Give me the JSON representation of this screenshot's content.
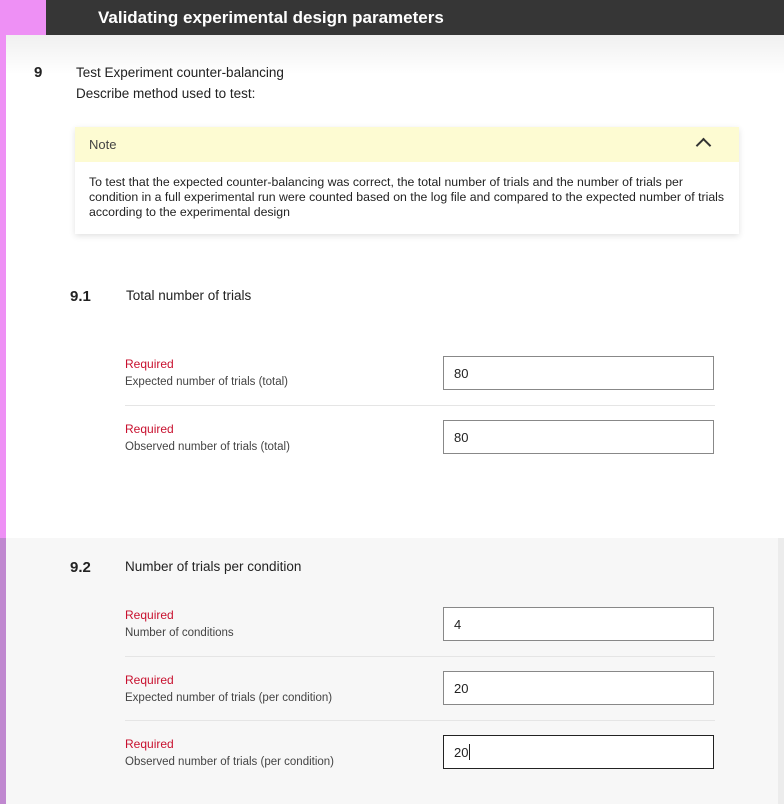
{
  "header": {
    "title": "Validating experimental design parameters"
  },
  "step": {
    "number": "9",
    "title": "Test Experiment counter-balancing",
    "description": "Describe method used to test:"
  },
  "note": {
    "title": "Note",
    "body": "To test that the expected counter-balancing was correct, the total number of trials and the number of trials per condition in a full experimental run were counted based on the log file and compared to the expected number  of trials according to the experimental design"
  },
  "sections": [
    {
      "number": "9.1",
      "title": "Total number of trials",
      "fields": [
        {
          "required": "Required",
          "label": "Expected number of trials (total)",
          "value": "80"
        },
        {
          "required": "Required",
          "label": "Observed number of trials (total)",
          "value": "80"
        }
      ]
    },
    {
      "number": "9.2",
      "title": "Number of trials per condition",
      "fields": [
        {
          "required": "Required",
          "label": "Number of conditions",
          "value": "4"
        },
        {
          "required": "Required",
          "label": "Expected number of trials (per condition)",
          "value": "20"
        },
        {
          "required": "Required",
          "label": "Observed number of trials (per condition)",
          "value": "20"
        }
      ]
    }
  ],
  "colors": {
    "accent_pink": "#ee90f5",
    "header_bg": "#363636",
    "note_header_bg": "#fdfbd2",
    "required_red": "#c8102e"
  },
  "icons": {
    "note_toggle": "chevron-up-icon"
  }
}
